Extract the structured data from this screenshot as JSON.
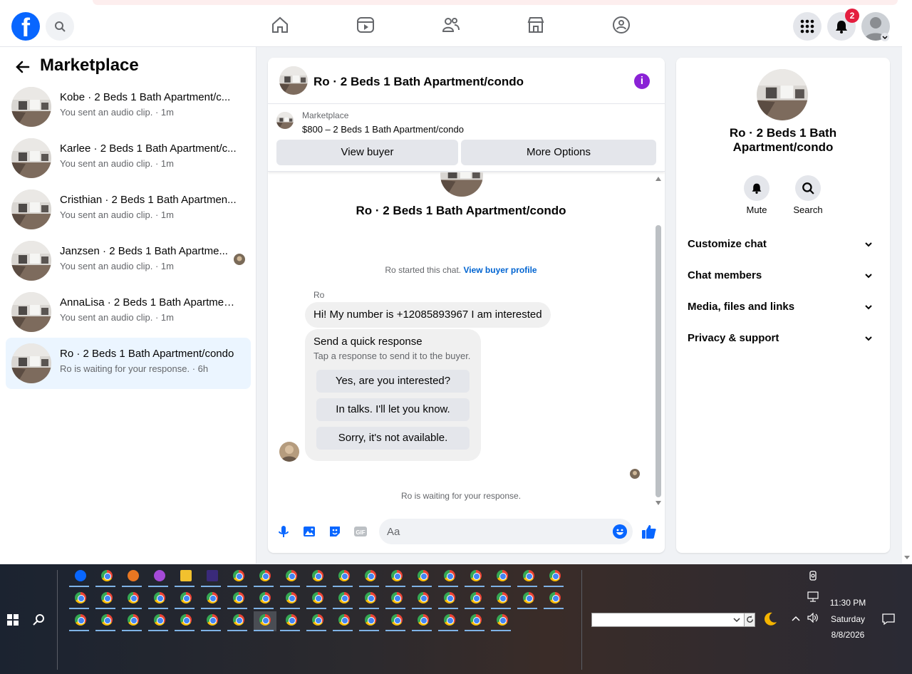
{
  "header": {
    "notification_count": "2",
    "nav": [
      "home-icon",
      "reels-icon",
      "friends-icon",
      "marketplace-icon",
      "groups-icon"
    ]
  },
  "sidebar": {
    "title": "Marketplace",
    "conversations": [
      {
        "name": "Kobe · 2 Beds 1 Bath Apartment/c...",
        "sub": "You sent an audio clip. · 1m"
      },
      {
        "name": "Karlee · 2 Beds 1 Bath Apartment/c...",
        "sub": "You sent an audio clip. · 1m"
      },
      {
        "name": "Cristhian · 2 Beds 1 Bath Apartmen...",
        "sub": "You sent an audio clip. · 1m"
      },
      {
        "name": "Janzsen · 2 Beds 1 Bath Apartme...",
        "sub": "You sent an audio clip. · 1m"
      },
      {
        "name": "AnnaLisa · 2 Beds 1 Bath Apartmen...",
        "sub": "You sent an audio clip. · 1m"
      },
      {
        "name": "Ro · 2 Beds 1 Bath Apartment/condo",
        "sub": "Ro is waiting for your response. · 6h"
      }
    ]
  },
  "chat": {
    "title": "Ro · 2 Beds 1 Bath Apartment/condo",
    "listing_label": "Marketplace",
    "listing_price": "$800 – 2 Beds 1 Bath Apartment/condo",
    "view_buyer": "View buyer",
    "more_options": "More Options",
    "intro_title": "Ro · 2 Beds 1 Bath Apartment/condo",
    "started_text": "Ro started this chat.",
    "view_profile": "View buyer profile",
    "sender": "Ro",
    "message": "Hi! My number is +12085893967 I am interested",
    "quick_title": "Send a quick response",
    "quick_sub": "Tap a response to send it to the buyer.",
    "quick_options": [
      "Yes, are you interested?",
      "In talks. I'll let you know.",
      "Sorry, it's not available."
    ],
    "waiting": "Ro is waiting for your response.",
    "composer_placeholder": "Aa"
  },
  "details": {
    "title": "Ro · 2 Beds 1 Bath Apartment/condo",
    "mute": "Mute",
    "search": "Search",
    "sections": [
      "Customize chat",
      "Chat members",
      "Media, files and links",
      "Privacy & support"
    ]
  },
  "taskbar": {
    "time": "11:30 PM",
    "day": "Saturday",
    "date": "8/8/2026"
  },
  "colors": {
    "brand": "#0866ff",
    "active_conv": "#ebf5ff",
    "info": "#8a22d6",
    "badge": "#e41e3f"
  }
}
